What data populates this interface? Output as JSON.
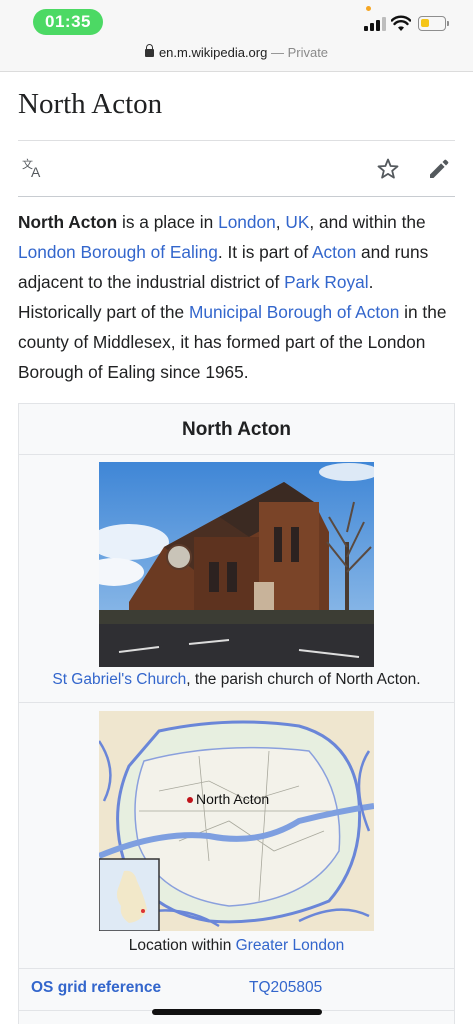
{
  "status_bar": {
    "time": "01:35"
  },
  "browser": {
    "url": "en.m.wikipedia.org",
    "private_label": "— Private"
  },
  "article": {
    "title": "North Acton",
    "toolbar": {
      "language_icon": "translate-icon",
      "watch_icon": "star-icon",
      "edit_icon": "pencil-icon"
    },
    "intro": {
      "t1": "North Acton",
      "t2": " is a place in ",
      "l1": "London",
      "t3": ", ",
      "l2": "UK",
      "t4": ", and within the ",
      "l3": "London Borough of Ealing",
      "t5": ". It is part of ",
      "l4": "Acton",
      "t6": " and runs adjacent to the industrial district of ",
      "l5": "Park Royal",
      "t7": ". Historically part of the ",
      "l6": "Municipal Borough of Acton",
      "t8": " in the county of Middlesex, it has formed part of the London Borough of Ealing since 1965."
    }
  },
  "infobox": {
    "title": "North Acton",
    "photo_caption_link": "St Gabriel's Church",
    "photo_caption_rest": ", the parish church of North Acton.",
    "map_label": "North Acton",
    "map_caption_text": "Location within ",
    "map_caption_link": "Greater London",
    "os_grid_label": "OS grid reference",
    "os_grid_value": "TQ205805"
  },
  "colors": {
    "link": "#3366cc",
    "time_pill": "#4cd964",
    "battery": "#f5c518"
  }
}
